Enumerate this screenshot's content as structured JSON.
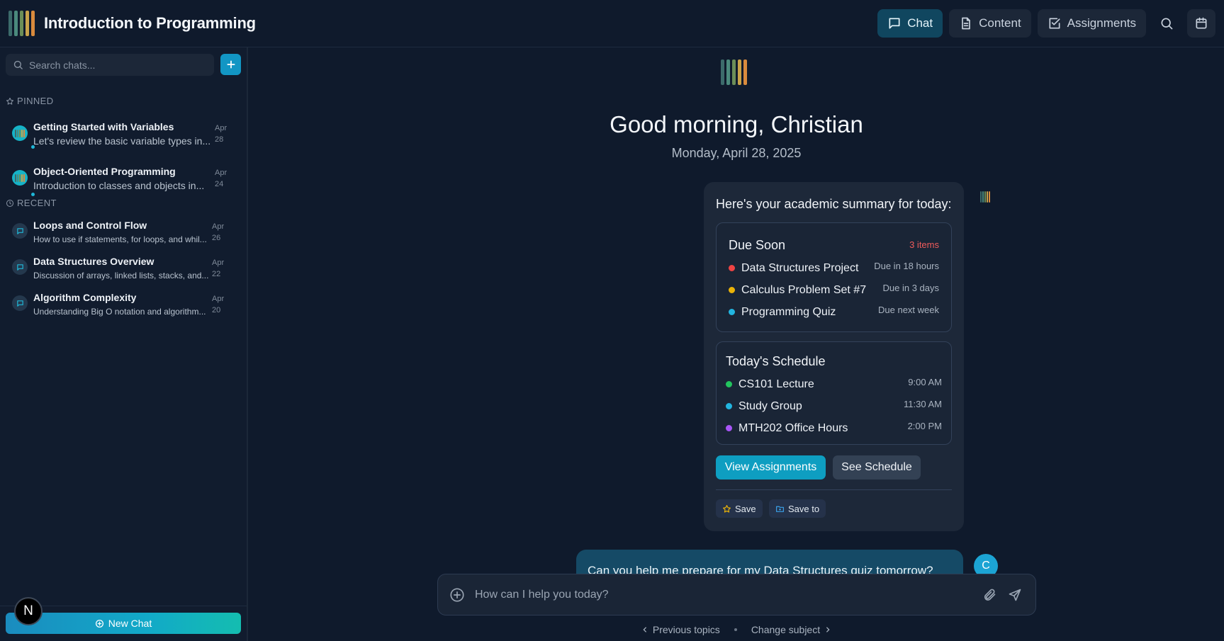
{
  "header": {
    "title": "Introduction to Programming",
    "tabs": [
      {
        "label": "Chat",
        "icon": "chat-icon",
        "active": true
      },
      {
        "label": "Content",
        "icon": "document-icon",
        "active": false
      },
      {
        "label": "Assignments",
        "icon": "checkbox-icon",
        "active": false
      }
    ],
    "actions": [
      "search-icon",
      "calendar-icon"
    ]
  },
  "logo_colors": [
    "#3c6b6b",
    "#4b8a7d",
    "#6c8e58",
    "#c9a34a",
    "#d98a3d"
  ],
  "sidebar": {
    "search_placeholder": "Search chats...",
    "pinned_label": "PINNED",
    "recent_label": "RECENT",
    "pinned": [
      {
        "title": "Getting Started with Variables",
        "subtitle": "Let's review the basic variable types in...",
        "date_month": "Apr",
        "date_day": "28",
        "unread": true
      },
      {
        "title": "Object-Oriented Programming",
        "subtitle": "Introduction to classes and objects in...",
        "date_month": "Apr",
        "date_day": "24",
        "unread": false
      }
    ],
    "recent": [
      {
        "title": "Loops and Control Flow",
        "subtitle": "How to use if statements, for loops, and whil...",
        "date_month": "Apr",
        "date_day": "26"
      },
      {
        "title": "Data Structures Overview",
        "subtitle": "Discussion of arrays, linked lists, stacks, and...",
        "date_month": "Apr",
        "date_day": "22"
      },
      {
        "title": "Algorithm Complexity",
        "subtitle": "Understanding Big O notation and algorithm...",
        "date_month": "Apr",
        "date_day": "20"
      }
    ],
    "new_chat_label": "New Chat",
    "user_badge": "N"
  },
  "main": {
    "greeting": "Good morning, Christian",
    "date": "Monday, April 28, 2025",
    "summary": {
      "heading": "Here's your academic summary for today:",
      "due_soon": {
        "title": "Due Soon",
        "count": "3 items",
        "items": [
          {
            "label": "Data Structures Project",
            "meta": "Due in 18 hours",
            "color": "#ef4444"
          },
          {
            "label": "Calculus Problem Set #7",
            "meta": "Due in 3 days",
            "color": "#eab308"
          },
          {
            "label": "Programming Quiz",
            "meta": "Due next week",
            "color": "#22b5e0"
          }
        ]
      },
      "schedule": {
        "title": "Today's Schedule",
        "items": [
          {
            "label": "CS101 Lecture",
            "meta": "9:00 AM",
            "color": "#22c55e"
          },
          {
            "label": "Study Group",
            "meta": "11:30 AM",
            "color": "#22b5e0"
          },
          {
            "label": "MTH202 Office Hours",
            "meta": "2:00 PM",
            "color": "#a855f7"
          }
        ]
      },
      "primary_action": "View Assignments",
      "secondary_action": "See Schedule",
      "save_label": "Save",
      "save_to_label": "Save to"
    },
    "user_message": "Can you help me prepare for my Data Structures quiz tomorrow?",
    "user_initial": "C",
    "composer_placeholder": "How can I help you today?",
    "footer": {
      "previous": "Previous topics",
      "change": "Change subject"
    }
  },
  "accent": "#1296c4"
}
